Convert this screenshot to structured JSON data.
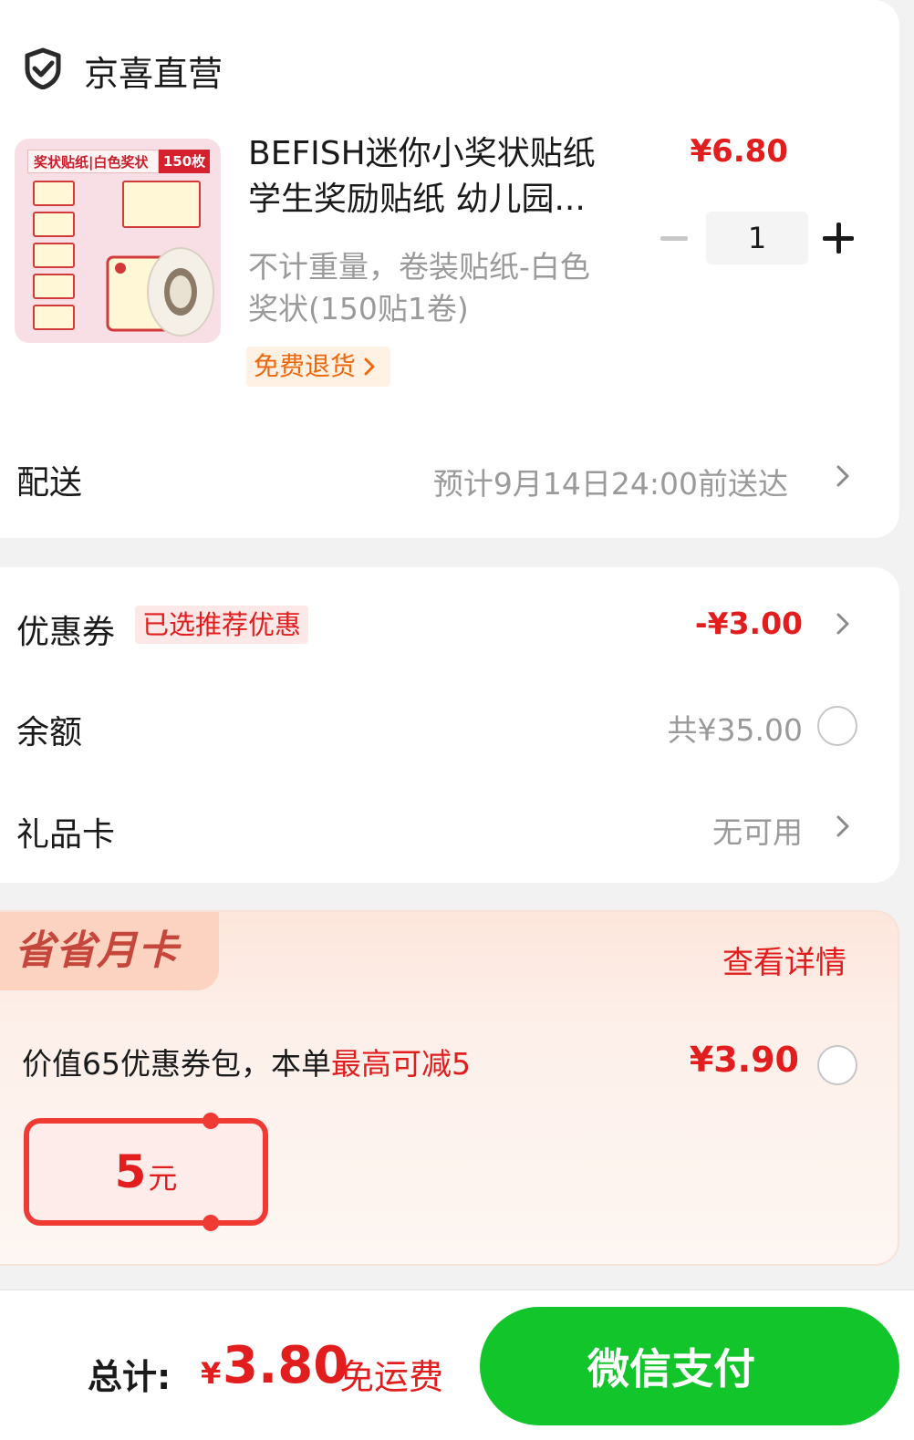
{
  "store": {
    "name": "京喜直营",
    "icon": "shield-check-icon"
  },
  "product": {
    "thumb_banner_left": "奖状贴纸|白色奖状",
    "thumb_banner_right": "150枚",
    "title": "BEFISH迷你小奖状贴纸学生奖励贴纸 幼儿园...",
    "price": "¥6.80",
    "spec": "不计重量，卷装贴纸-白色奖状(150贴1卷)",
    "return_tag": "免费退货",
    "quantity": "1"
  },
  "delivery": {
    "label": "配送",
    "value": "预计9月14日24:00前送达"
  },
  "payment": {
    "coupon_label": "优惠券",
    "coupon_tag": "已选推荐优惠",
    "coupon_value": "-¥3.00",
    "balance_label": "余额",
    "balance_value": "共¥35.00",
    "giftcard_label": "礼品卡",
    "giftcard_value": "无可用"
  },
  "monthly_card": {
    "logo": "省省月卡",
    "detail_link": "查看详情",
    "desc_prefix": "价值65优惠券包，本单",
    "desc_highlight": "最高可减5",
    "price": "¥3.90",
    "voucher_amount": "5",
    "voucher_unit": "元"
  },
  "footer": {
    "total_label": "总计:",
    "currency": "¥",
    "total_amount": "3.80",
    "shipping": "免运费",
    "pay_button": "微信支付"
  },
  "colors": {
    "accent_red": "#e21d1d",
    "pay_green": "#12c52b",
    "return_orange": "#f0660a"
  }
}
